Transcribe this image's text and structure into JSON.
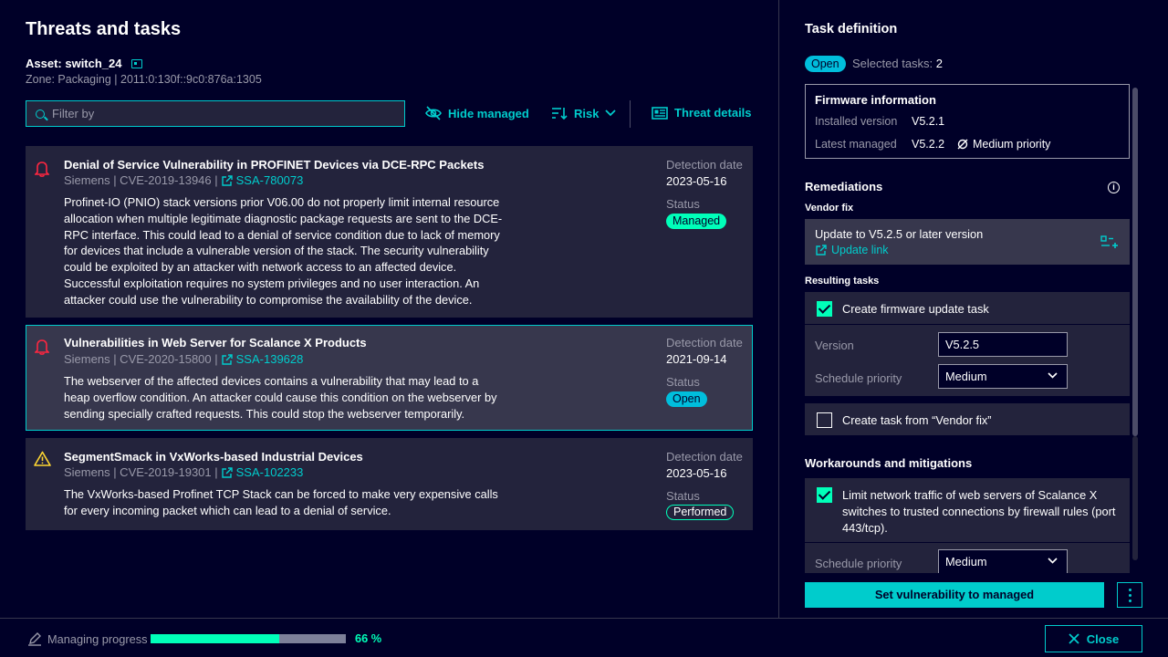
{
  "page": {
    "title": "Threats and tasks",
    "asset_label": "Asset: switch_24",
    "zone": "Zone: Packaging | 2011:0:130f::9c0:876a:1305"
  },
  "toolbar": {
    "filter_placeholder": "Filter by",
    "hide_managed": "Hide managed",
    "risk": "Risk",
    "threat_details": "Threat details"
  },
  "threats": [
    {
      "title": "Denial of Service Vulnerability in PROFINET Devices via DCE-RPC Packets",
      "vendor_cve": "Siemens | CVE-2019-13946 |",
      "ssa": "SSA-780073",
      "description": "Profinet-IO (PNIO) stack versions prior V06.00 do not properly limit internal resource allocation when multiple legitimate diagnostic package requests are sent to the DCE-RPC interface. This could lead to a denial of service condition due to lack of memory for devices that include a vulnerable version of the stack. The security vulnerability could be exploited by an attacker with network access to an affected device. Successful exploitation requires no system privileges and no user interaction. An attacker could use the vulnerability to compromise the availability of the device.",
      "detection_label": "Detection date",
      "detection_date": "2023-05-16",
      "status_label": "Status",
      "status": "Managed",
      "icon": "bell-icon"
    },
    {
      "title": "Vulnerabilities in Web Server for Scalance X Products",
      "vendor_cve": "Siemens | CVE-2020-15800 |",
      "ssa": "SSA-139628",
      "description": "The webserver of the affected devices contains a vulnerability that may lead to a heap overflow condition. An attacker could cause this condition on the webserver by sending specially crafted requests. This could stop the webserver temporarily.",
      "detection_label": "Detection date",
      "detection_date": "2021-09-14",
      "status_label": "Status",
      "status": "Open",
      "icon": "bell-icon"
    },
    {
      "title": "SegmentSmack in VxWorks-based Industrial Devices",
      "vendor_cve": "Siemens | CVE-2019-19301 |",
      "ssa": "SSA-102233",
      "description": "The VxWorks-based Profinet TCP Stack can be forced to make very expensive calls for every incoming packet which can lead to a denial of service.",
      "detection_label": "Detection date",
      "detection_date": "2023-05-16",
      "status_label": "Status",
      "status": "Performed",
      "icon": "warning-icon"
    }
  ],
  "task": {
    "title": "Task definition",
    "status": "Open",
    "selected_tasks_label": "Selected tasks:",
    "selected_tasks_count": "2",
    "firmware": {
      "heading": "Firmware information",
      "installed_label": "Installed version",
      "installed_value": "V5.2.1",
      "latest_label": "Latest managed",
      "latest_value": "V5.2.2",
      "priority": "Medium priority"
    },
    "remediations": "Remediations",
    "vendor_fix_label": "Vendor fix",
    "vendor_fix_text": "Update to V5.2.5 or later version",
    "update_link": "Update link",
    "resulting_tasks": "Resulting tasks",
    "create_fw_task": "Create firmware update task",
    "version_label": "Version",
    "version_value": "V5.2.5",
    "schedule_label": "Schedule priority",
    "schedule_value": "Medium",
    "create_vendor_task": "Create task from “Vendor fix”",
    "workarounds": "Workarounds and mitigations",
    "workaround_text": "Limit network traffic of web servers of Scalance X switches to trusted connections by firewall rules (port 443/tcp).",
    "workaround_schedule_label": "Schedule priority",
    "workaround_schedule_value": "Medium",
    "cta": "Set vulnerability to managed"
  },
  "footer": {
    "progress_label": "Managing progress",
    "progress_value": 0.66,
    "progress_text": "66 %",
    "close": "Close"
  },
  "colors": {
    "background": "#000028",
    "accent": "#00cccc",
    "managed": "#00ffb9",
    "open": "#00bedc",
    "warning": "#ffd732",
    "alert": "#ff2640"
  }
}
